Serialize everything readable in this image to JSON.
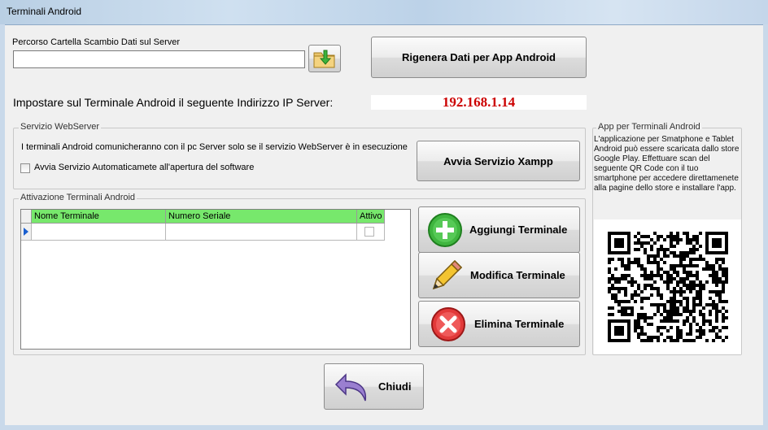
{
  "window": {
    "title": "Terminali Android"
  },
  "folder": {
    "label": "Percorso Cartella Scambio Dati sul Server",
    "value": ""
  },
  "buttons": {
    "regenerate": "Rigenera Dati per App Android",
    "start_xampp": "Avvia Servizio Xampp",
    "add": "Aggiungi Terminale",
    "edit": "Modifica Terminale",
    "delete": "Elimina Terminale",
    "close": "Chiudi"
  },
  "ip": {
    "label": "Impostare sul Terminale Android il seguente Indirizzo IP Server:",
    "value": "192.168.1.14",
    "color": "#cc0000"
  },
  "webserver": {
    "legend": "Servizio WebServer",
    "info": "I terminali Android comunicheranno con il pc Server solo se il servizio WebServer è in esecuzione",
    "autostart_label": "Avvia Servizio Automaticamete all'apertura del software",
    "autostart_checked": false
  },
  "terminals": {
    "legend": "Attivazione Terminali Android",
    "columns": [
      "Nome Terminale",
      "Numero Seriale",
      "Attivo"
    ],
    "header_color": "#77e86c",
    "rows": [
      {
        "name": "",
        "serial": "",
        "active": false
      }
    ]
  },
  "app_panel": {
    "legend": "App per Terminali Android",
    "text": "L'applicazione per Smatphone e Tablet Android può essere scaricata dallo store Google Play. Effettuare scan del seguente QR Code con il tuo smartphone per accedere direttamenete alla pagine dello store e installare l'app."
  },
  "icons": {
    "folder": "folder-arrow-icon",
    "add": "plus-circle-icon",
    "edit": "pencil-icon",
    "delete": "x-circle-icon",
    "close": "undo-arrow-icon",
    "qr": "qr-code-icon"
  }
}
